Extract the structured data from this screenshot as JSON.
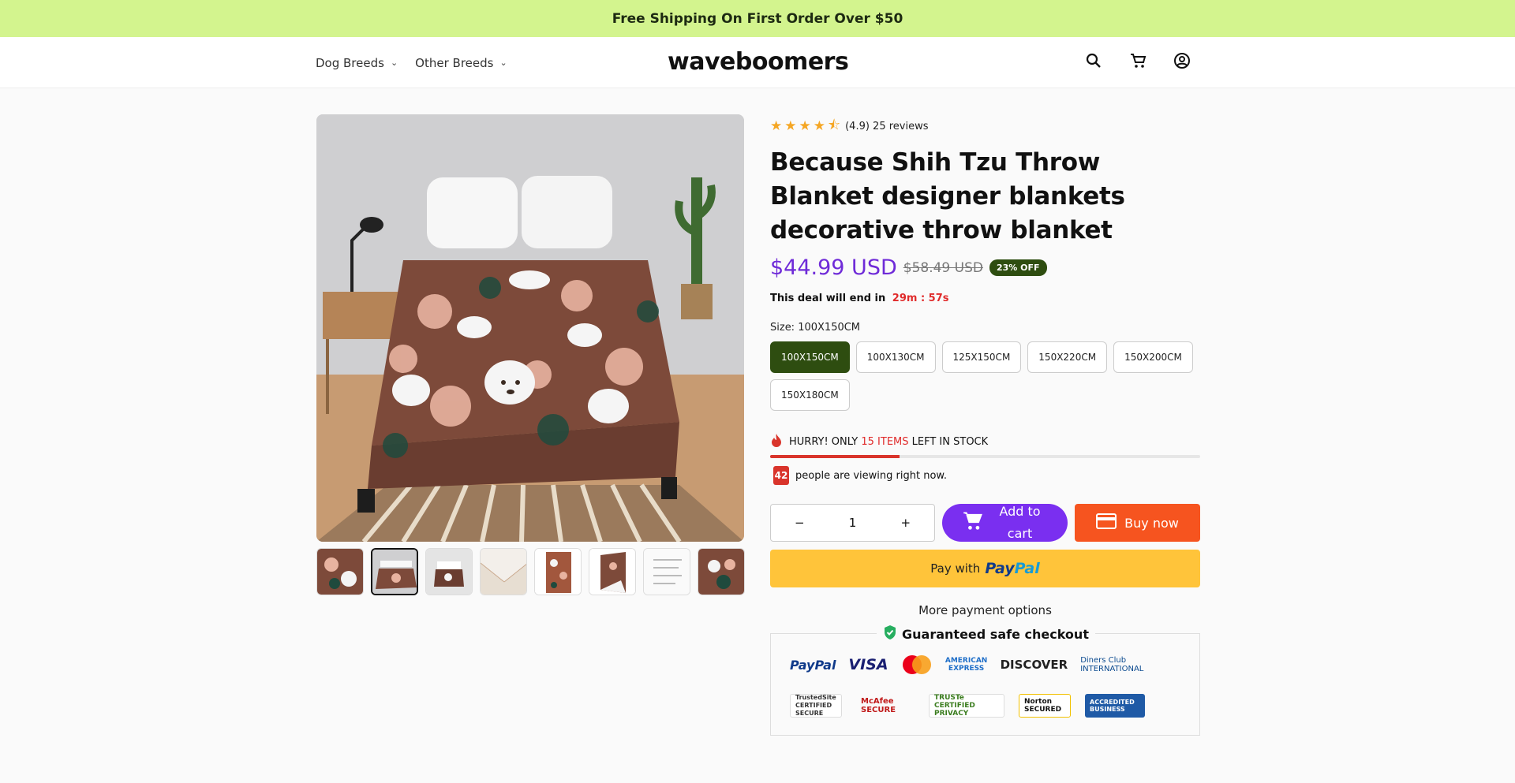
{
  "announcement": "Free Shipping On First Order Over $50",
  "header": {
    "nav": [
      {
        "label": "Dog Breeds"
      },
      {
        "label": "Other Breeds"
      }
    ],
    "logo": "waveboomers",
    "icons": [
      "search-icon",
      "cart-icon",
      "account-icon"
    ]
  },
  "gallery": {
    "thumb_count": 8,
    "active_index": 1
  },
  "product": {
    "rating_value": 4.5,
    "rating_text": "(4.9) 25 reviews",
    "title": "Because Shih Tzu Throw Blanket designer blankets decorative throw blanket",
    "price": "$44.99 USD",
    "compare_price": "$58.49 USD",
    "discount_badge": "23% OFF",
    "deal_text": "This deal will end in",
    "deal_timer": "29m : 57s",
    "size_label": "Size: 100X150CM",
    "sizes": [
      "100X150CM",
      "100X130CM",
      "125X150CM",
      "150X220CM",
      "150X200CM",
      "150X180CM"
    ],
    "selected_size": "100X150CM",
    "stock_prefix": "HURRY! ONLY",
    "stock_count": "15 ITEMS",
    "stock_suffix": "LEFT IN STOCK",
    "stock_fraction": 0.3,
    "viewers": "42",
    "viewers_text": "people are viewing right now.",
    "quantity": "1",
    "qty_minus": "−",
    "qty_plus": "+",
    "add_to_cart": "Add to cart",
    "buy_now": "Buy now",
    "paypal_prefix": "Pay with",
    "paypal_a": "Pay",
    "paypal_b": "Pal",
    "more_payment": "More payment options",
    "safe_checkout": "Guaranteed safe checkout",
    "payment_logos": [
      "PayPal",
      "VISA",
      "Mastercard",
      "AMERICAN EXPRESS",
      "DISCOVER",
      "Diners Club INTERNATIONAL"
    ],
    "trust_badges": [
      "TrustedSite CERTIFIED SECURE",
      "McAfee SECURE",
      "TRUSTe CERTIFIED PRIVACY",
      "Norton SECURED",
      "ACCREDITED BUSINESS"
    ]
  },
  "colors": {
    "accent_purple": "#7a2ff0",
    "buy_orange": "#f6541f",
    "badge_green": "#2e4d10",
    "announce_bg": "#d3f48e",
    "paypal_yellow": "#ffc43a"
  }
}
